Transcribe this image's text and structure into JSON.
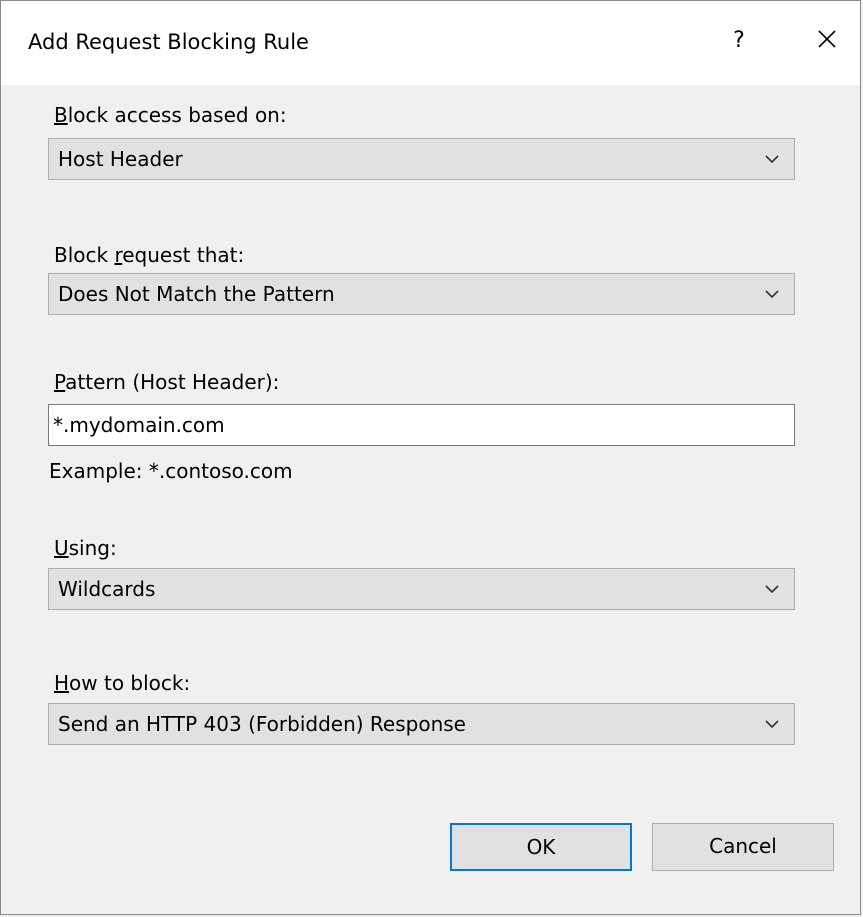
{
  "window": {
    "title": "Add Request Blocking Rule",
    "help_label": "?",
    "close_icon": "close-icon"
  },
  "block_access": {
    "label_mnemonic": "B",
    "label_rest": "lock access based on:",
    "value": "Host Header"
  },
  "block_request": {
    "label_pre": "Block ",
    "label_mnemonic": "r",
    "label_rest": "equest that:",
    "value": "Does Not Match the Pattern"
  },
  "pattern": {
    "label_mnemonic": "P",
    "label_rest": "attern (Host Header):",
    "value": "*.mydomain.com",
    "example": "Example: *.contoso.com"
  },
  "using": {
    "label_mnemonic": "U",
    "label_rest": "sing:",
    "value": "Wildcards"
  },
  "how_to_block": {
    "label_mnemonic": "H",
    "label_rest": "ow to block:",
    "value": "Send an HTTP 403 (Forbidden) Response"
  },
  "buttons": {
    "ok_label": "OK",
    "cancel_label": "Cancel"
  },
  "colors": {
    "accent": "#0078d7",
    "dialog_bg": "#f0f0f0",
    "combo_bg": "#e1e1e1"
  }
}
